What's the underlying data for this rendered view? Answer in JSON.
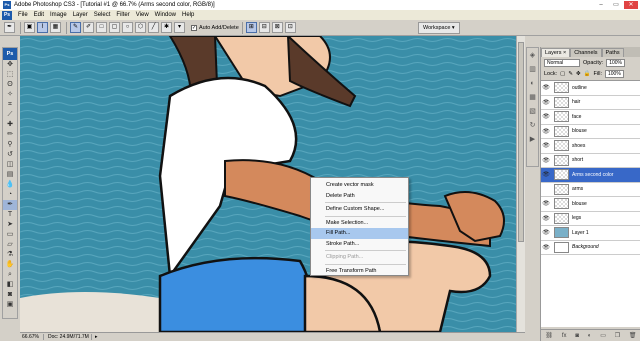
{
  "window": {
    "title": "Adobe Photoshop CS3 - [Tutorial #1 @ 66.7% (Arms second color, RGB/8)]",
    "app_badge": "Ps"
  },
  "window_controls": {
    "minimize": "–",
    "restore": "▭",
    "close": "✕"
  },
  "menu": [
    "File",
    "Edit",
    "Image",
    "Layer",
    "Select",
    "Filter",
    "View",
    "Window",
    "Help"
  ],
  "options": {
    "auto_add_delete": "Auto Add/Delete",
    "auto_add_checked": "✓",
    "workspace": "Workspace ▾"
  },
  "toolbox_badge": "Ps",
  "status": {
    "zoom": "66.67%",
    "doc": "Doc: 24.9M/71.7M",
    "arrow": "▸"
  },
  "context_menu": {
    "items": [
      {
        "label": "Create vector mask",
        "state": "normal"
      },
      {
        "label": "Delete Path",
        "state": "normal"
      },
      {
        "sep": true
      },
      {
        "label": "Define Custom Shape...",
        "state": "normal"
      },
      {
        "sep": true
      },
      {
        "label": "Make Selection...",
        "state": "normal"
      },
      {
        "label": "Fill Path...",
        "state": "highlighted"
      },
      {
        "label": "Stroke Path...",
        "state": "normal"
      },
      {
        "sep": true
      },
      {
        "label": "Clipping Path...",
        "state": "disabled"
      },
      {
        "sep": true
      },
      {
        "label": "Free Transform Path",
        "state": "normal"
      }
    ]
  },
  "panel": {
    "tabs": [
      "Layers ×",
      "Channels",
      "Paths"
    ],
    "blend_mode": "Normal",
    "opacity_label": "Opacity:",
    "opacity_value": "100%",
    "lock_label": "Lock:",
    "fill_label": "Fill:",
    "fill_value": "100%",
    "layers": [
      {
        "name": "outline",
        "visible": true,
        "selected": false
      },
      {
        "name": "hair",
        "visible": true,
        "selected": false
      },
      {
        "name": "face",
        "visible": true,
        "selected": false
      },
      {
        "name": "blouse",
        "visible": true,
        "selected": false
      },
      {
        "name": "shoes",
        "visible": true,
        "selected": false
      },
      {
        "name": "short",
        "visible": true,
        "selected": false
      },
      {
        "name": "Arms second color",
        "visible": true,
        "selected": true
      },
      {
        "name": "arms",
        "visible": false,
        "selected": false
      },
      {
        "name": "blouse",
        "visible": true,
        "selected": false
      },
      {
        "name": "legs",
        "visible": true,
        "selected": false
      },
      {
        "name": "Layer 1",
        "visible": true,
        "selected": false
      },
      {
        "name": "Background",
        "visible": true,
        "selected": false
      }
    ],
    "footer_icons": [
      "link-icon",
      "fx-icon",
      "mask-icon",
      "adjustment-icon",
      "folder-icon",
      "new-layer-icon",
      "trash-icon"
    ]
  },
  "colors": {
    "selected_layer": "#3868c8",
    "menu_highlight": "#a8c8ee",
    "sea": "#3a8ea8",
    "skin": "#f2c9a8",
    "shorts": "#3b8ee0"
  }
}
